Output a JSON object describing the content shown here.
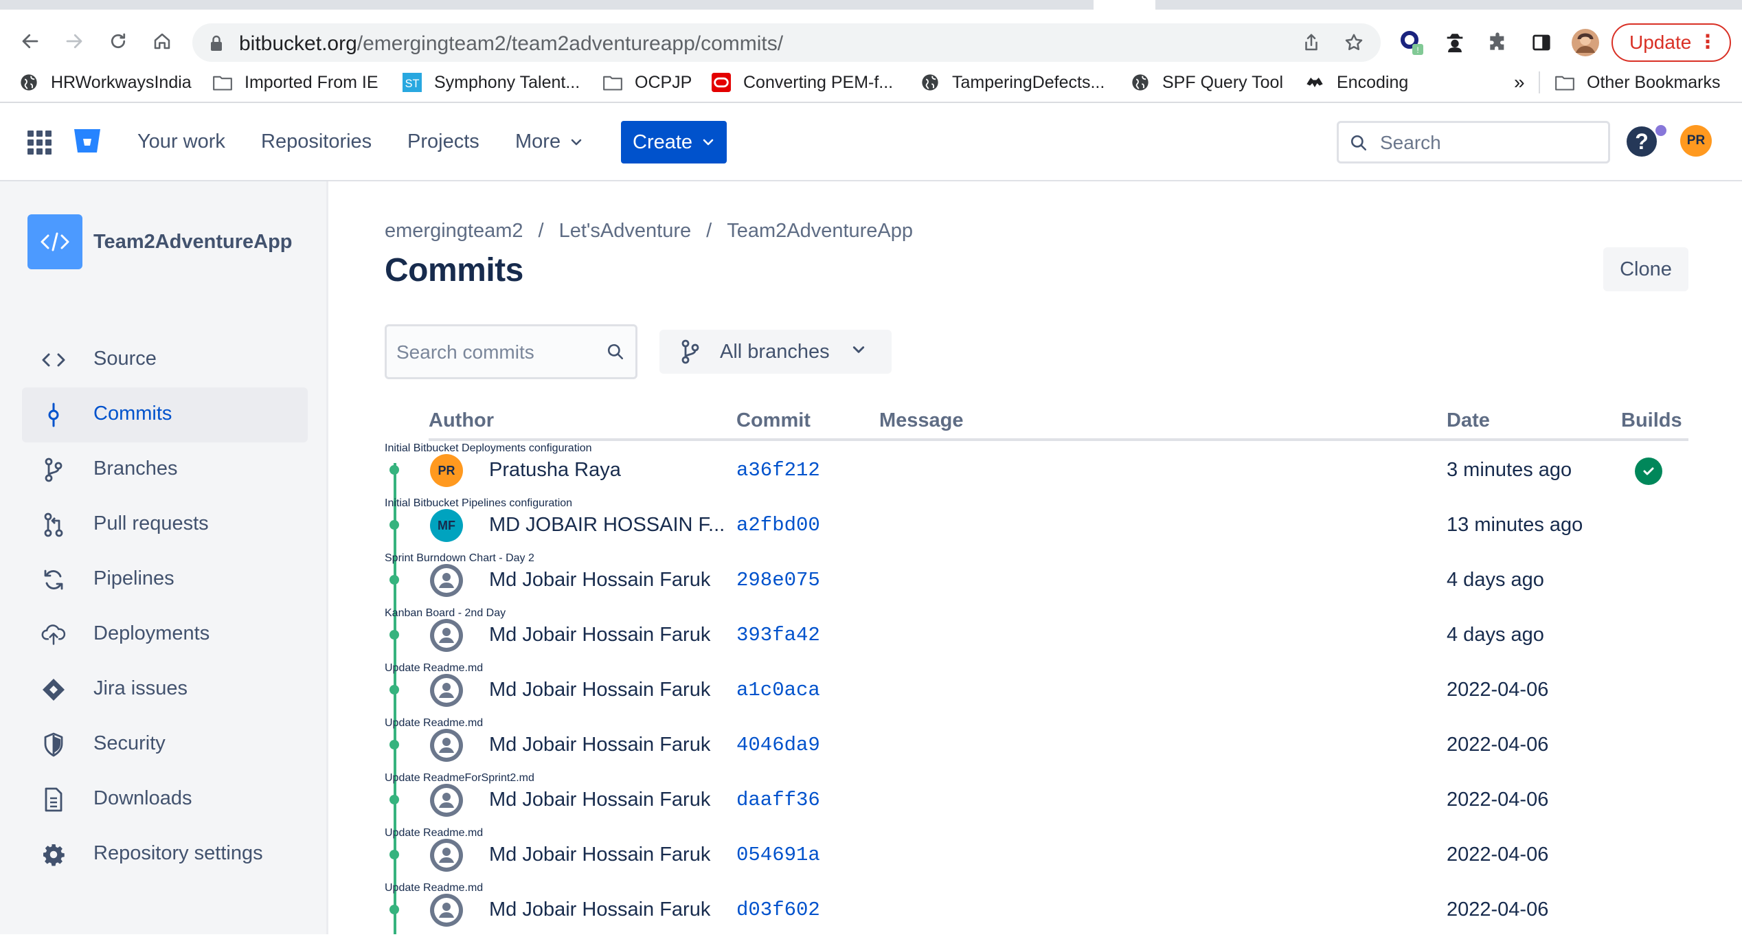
{
  "browser": {
    "url_host": "bitbucket.org",
    "url_path": "/emergingteam2/team2adventureapp/commits/",
    "update_label": "Update",
    "bookmarks": [
      {
        "label": "HRWorkwaysIndia",
        "icon": "globe-icon"
      },
      {
        "label": "Imported From IE",
        "icon": "folder-icon"
      },
      {
        "label": "Symphony Talent...",
        "icon": "st-logo-icon"
      },
      {
        "label": "OCPJP",
        "icon": "folder-icon"
      },
      {
        "label": "Converting PEM-f...",
        "icon": "oracle-logo-icon"
      },
      {
        "label": "TamperingDefects...",
        "icon": "globe-icon"
      },
      {
        "label": "SPF Query Tool",
        "icon": "globe-icon"
      },
      {
        "label": "Encoding",
        "icon": "fox-icon"
      }
    ],
    "bookmarks_overflow": "»",
    "other_bookmarks": "Other Bookmarks"
  },
  "topnav": {
    "your_work": "Your work",
    "repositories": "Repositories",
    "projects": "Projects",
    "more": "More",
    "create": "Create",
    "search_placeholder": "Search",
    "help": "?",
    "user_initials": "PR"
  },
  "sidebar": {
    "repo_name": "Team2AdventureApp",
    "items": [
      {
        "label": "Source",
        "icon": "code-icon"
      },
      {
        "label": "Commits",
        "icon": "commit-icon",
        "active": true
      },
      {
        "label": "Branches",
        "icon": "branch-icon"
      },
      {
        "label": "Pull requests",
        "icon": "pull-request-icon"
      },
      {
        "label": "Pipelines",
        "icon": "pipelines-icon"
      },
      {
        "label": "Deployments",
        "icon": "deployments-icon"
      },
      {
        "label": "Jira issues",
        "icon": "jira-icon"
      },
      {
        "label": "Security",
        "icon": "shield-icon"
      },
      {
        "label": "Downloads",
        "icon": "document-icon"
      },
      {
        "label": "Repository settings",
        "icon": "gear-icon"
      }
    ]
  },
  "main": {
    "breadcrumbs": [
      "emergingteam2",
      "Let'sAdventure",
      "Team2AdventureApp"
    ],
    "breadcrumb_sep": "/",
    "title": "Commits",
    "clone_label": "Clone",
    "search_placeholder": "Search commits",
    "branch_filter": "All branches",
    "columns": {
      "author": "Author",
      "commit": "Commit",
      "message": "Message",
      "date": "Date",
      "builds": "Builds"
    },
    "commits": [
      {
        "avatar": "PR",
        "avatar_color": "#ff991f",
        "author": "Pratusha Raya",
        "hash": "a36f212",
        "message": "Initial Bitbucket Deployments configuration",
        "date": "3 minutes ago",
        "build": "success"
      },
      {
        "avatar": "MF",
        "avatar_color": "#00a3bf",
        "author": "MD JOBAIR HOSSAIN F...",
        "hash": "a2fbd00",
        "message": "Initial Bitbucket Pipelines configuration",
        "date": "13 minutes ago",
        "build": ""
      },
      {
        "avatar": "",
        "avatar_color": "#6b778c",
        "author": "Md Jobair Hossain Faruk",
        "hash": "298e075",
        "message": "Sprint Burndown Chart - Day 2",
        "date": "4 days ago",
        "build": ""
      },
      {
        "avatar": "",
        "avatar_color": "#6b778c",
        "author": "Md Jobair Hossain Faruk",
        "hash": "393fa42",
        "message": "Kanban Board - 2nd Day",
        "date": "4 days ago",
        "build": ""
      },
      {
        "avatar": "",
        "avatar_color": "#6b778c",
        "author": "Md Jobair Hossain Faruk",
        "hash": "a1c0aca",
        "message": "Update Readme.md",
        "date": "2022-04-06",
        "build": ""
      },
      {
        "avatar": "",
        "avatar_color": "#6b778c",
        "author": "Md Jobair Hossain Faruk",
        "hash": "4046da9",
        "message": "Update Readme.md",
        "date": "2022-04-06",
        "build": ""
      },
      {
        "avatar": "",
        "avatar_color": "#6b778c",
        "author": "Md Jobair Hossain Faruk",
        "hash": "daaff36",
        "message": "Update ReadmeForSprint2.md",
        "date": "2022-04-06",
        "build": ""
      },
      {
        "avatar": "",
        "avatar_color": "#6b778c",
        "author": "Md Jobair Hossain Faruk",
        "hash": "054691a",
        "message": "Update Readme.md",
        "date": "2022-04-06",
        "build": ""
      },
      {
        "avatar": "",
        "avatar_color": "#6b778c",
        "author": "Md Jobair Hossain Faruk",
        "hash": "d03f602",
        "message": "Update Readme.md",
        "date": "2022-04-06",
        "build": ""
      }
    ]
  },
  "colors": {
    "brand": "#0052cc",
    "success": "#00875a",
    "graph": "#36b37e"
  }
}
